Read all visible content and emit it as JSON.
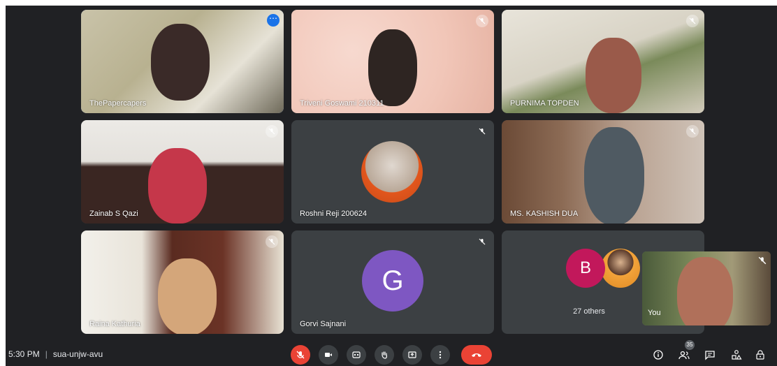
{
  "participants": [
    {
      "name": "ThePapercapers"
    },
    {
      "name": "Triveni Goswami 210311"
    },
    {
      "name": "PURNIMA TOPDEN"
    },
    {
      "name": "Zainab S Qazi"
    },
    {
      "name": "Roshni Reji 200624"
    },
    {
      "name": "MS. KASHISH DUA"
    },
    {
      "name": "Raina Kathuria"
    },
    {
      "name": "Gorvi Sajnani",
      "initial": "G",
      "avatar_color": "#7e57c2"
    }
  ],
  "others_tile": {
    "initial": "B",
    "avatar_color": "#c2185b",
    "label": "27 others"
  },
  "self_view": {
    "label": "You"
  },
  "meeting": {
    "time": "5:30 PM",
    "code": "sua-unjw-avu"
  },
  "people_count": "35",
  "controls": [
    "mic-off-icon",
    "camera-icon",
    "captions-icon",
    "raise-hand-icon",
    "present-icon",
    "more-options-icon",
    "end-call-icon"
  ],
  "right_controls": [
    "info-icon",
    "people-icon",
    "chat-icon",
    "activities-icon",
    "host-controls-icon"
  ],
  "colors": {
    "background": "#202124",
    "tile": "#3c4043",
    "accent": "#1a73e8",
    "end_call": "#ea4335"
  }
}
